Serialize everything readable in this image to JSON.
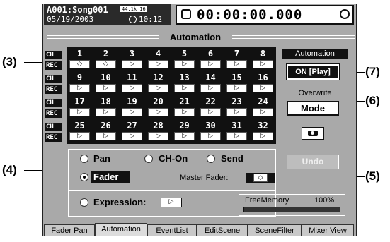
{
  "header": {
    "song": "A001:Song001",
    "sample_rate": "44.1k 16",
    "date": "05/19/2003",
    "clock_icon": "clock-icon",
    "time": "10:12",
    "counter": "00:00:00.000",
    "counter_icon": "timer-icon"
  },
  "title": "Automation",
  "callouts": {
    "c3": "(3)",
    "c4": "(4)",
    "c5": "(5)",
    "c6": "(6)",
    "c7": "(7)"
  },
  "row_labels": [
    {
      "ch": "CH",
      "rec": "REC"
    },
    {
      "ch": "CH",
      "rec": "REC"
    },
    {
      "ch": "CH",
      "rec": "REC"
    },
    {
      "ch": "CH",
      "rec": "REC"
    }
  ],
  "channels": [
    [
      "1",
      "2",
      "3",
      "4",
      "5",
      "6",
      "7",
      "8"
    ],
    [
      "9",
      "10",
      "11",
      "12",
      "13",
      "14",
      "15",
      "16"
    ],
    [
      "17",
      "18",
      "19",
      "20",
      "21",
      "22",
      "23",
      "24"
    ],
    [
      "25",
      "26",
      "27",
      "28",
      "29",
      "30",
      "31",
      "32"
    ]
  ],
  "rec_states": [
    [
      "◇",
      "◇",
      "▷",
      "▷",
      "▷",
      "▷",
      "▷",
      "▷"
    ],
    [
      "▷",
      "▷",
      "▷",
      "▷",
      "▷",
      "▷",
      "▷",
      "▷"
    ],
    [
      "▷",
      "▷",
      "▷",
      "▷",
      "▷",
      "▷",
      "▷",
      "▷"
    ],
    [
      "▷",
      "▷",
      "▷",
      "▷",
      "▷",
      "▷",
      "▷",
      "▷"
    ]
  ],
  "automation": {
    "label": "Automation",
    "button": "ON [Play]"
  },
  "overwrite": {
    "label": "Overwrite",
    "button": "Mode"
  },
  "camera_icon": "camera-icon",
  "undo": "Undo",
  "params": {
    "pan": "Pan",
    "ch_on": "CH-On",
    "send": "Send",
    "fader": "Fader",
    "master_fader": "Master Fader:",
    "master_state": "◇",
    "expression": "Expression:",
    "expression_state": "▷"
  },
  "free_memory": {
    "label": "FreeMemory",
    "value": "100%",
    "fraction": 1.0
  },
  "tabs": [
    "Fader Pan",
    "Automation",
    "EventList",
    "EditScene",
    "SceneFilter",
    "Mixer View"
  ],
  "active_tab": "Automation"
}
